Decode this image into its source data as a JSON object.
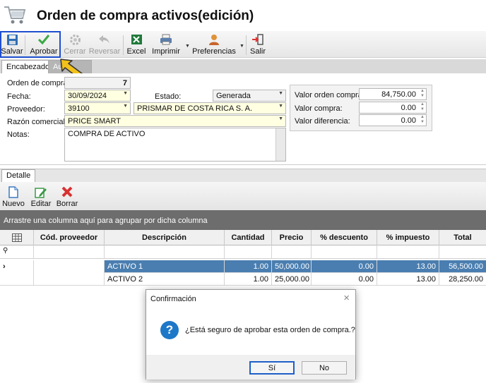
{
  "window": {
    "title": "Orden de compra activos(edición)"
  },
  "toolbar": {
    "salvar": "Salvar",
    "aprobar": "Aprobar",
    "cerrar": "Cerrar",
    "reversar": "Reversar",
    "excel": "Excel",
    "imprimir": "Imprimir",
    "preferencias": "Preferencias",
    "salir": "Salir"
  },
  "tabs": {
    "encabezado": "Encabezado",
    "second": "Au"
  },
  "header": {
    "orden_label": "Orden de compra:",
    "orden_value": "7",
    "fecha_label": "Fecha:",
    "fecha_value": "30/09/2024",
    "estado_label": "Estado:",
    "estado_value": "Generada",
    "proveedor_label": "Proveedor:",
    "proveedor_code": "39100",
    "proveedor_name": "PRISMAR DE COSTA RICA S. A.",
    "razon_label": "Razón comercial:",
    "razon_value": "PRICE SMART",
    "notas_label": "Notas:",
    "notas_value": "COMPRA DE ACTIVO"
  },
  "summary": {
    "valor_orden_label": "Valor orden compra:",
    "valor_orden_value": "84,750.00",
    "valor_compra_label": "Valor compra:",
    "valor_compra_value": "0.00",
    "valor_diferencia_label": "Valor diferencia:",
    "valor_diferencia_value": "0.00"
  },
  "detail": {
    "tab": "Detalle",
    "nuevo": "Nuevo",
    "editar": "Editar",
    "borrar": "Borrar",
    "group_hint": "Arrastre una columna aquí para agrupar por dicha columna",
    "columns": [
      "Cód. proveedor",
      "Descripción",
      "Cantidad",
      "Precio",
      "% descuento",
      "% impuesto",
      "Total"
    ],
    "rows": [
      {
        "cod": "",
        "desc": "ACTIVO 1",
        "cant": "1.00",
        "precio": "50,000.00",
        "desc_pct": "0.00",
        "imp": "13.00",
        "total": "56,500.00"
      },
      {
        "cod": "",
        "desc": "ACTIVO 2",
        "cant": "1.00",
        "precio": "25,000.00",
        "desc_pct": "0.00",
        "imp": "13.00",
        "total": "28,250.00"
      }
    ]
  },
  "dialog": {
    "title": "Confirmación",
    "message": "¿Está seguro de aprobar esta orden de compra.?",
    "yes": "Sí",
    "no": "No"
  },
  "colors": {
    "selected_row": "#4a7eb0",
    "highlight_box": "#1f4fcf",
    "arrow": "#f2c21b",
    "required_field": "#ffffe1"
  }
}
